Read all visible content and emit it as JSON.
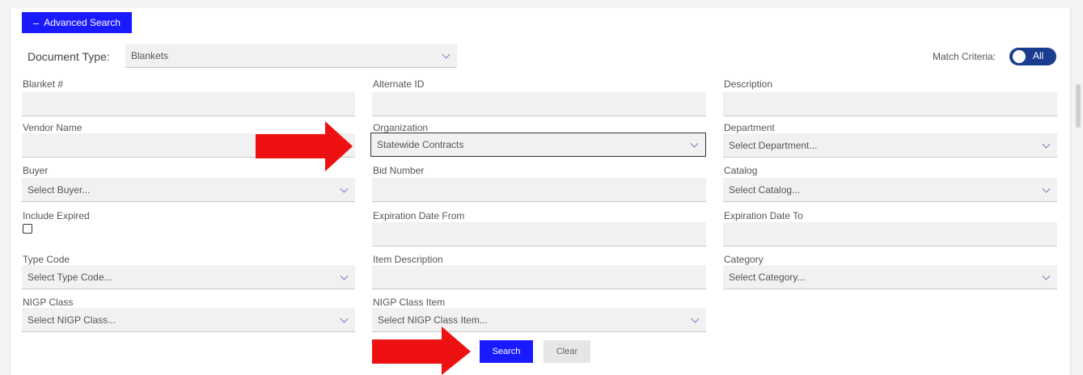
{
  "advanced_search": {
    "icon": "minus-icon",
    "label": "Advanced Search"
  },
  "document_type": {
    "label": "Document Type:",
    "value": "Blankets"
  },
  "match_criteria": {
    "label": "Match Criteria:",
    "value": "All"
  },
  "fields": {
    "blanket_number": {
      "label": "Blanket #"
    },
    "alternate_id": {
      "label": "Alternate ID"
    },
    "description": {
      "label": "Description"
    },
    "vendor_name": {
      "label": "Vendor Name"
    },
    "organization": {
      "label": "Organization",
      "value": "Statewide Contracts"
    },
    "department": {
      "label": "Department",
      "placeholder": "Select Department..."
    },
    "buyer": {
      "label": "Buyer",
      "placeholder": "Select Buyer..."
    },
    "bid_number": {
      "label": "Bid Number"
    },
    "catalog": {
      "label": "Catalog",
      "placeholder": "Select Catalog..."
    },
    "include_expired": {
      "label": "Include Expired",
      "checked": false
    },
    "expiration_date_from": {
      "label": "Expiration Date From"
    },
    "expiration_date_to": {
      "label": "Expiration Date To"
    },
    "type_code": {
      "label": "Type Code",
      "placeholder": "Select Type Code..."
    },
    "item_description": {
      "label": "Item Description"
    },
    "category": {
      "label": "Category",
      "placeholder": "Select Category..."
    },
    "nigp_class": {
      "label": "NIGP Class",
      "placeholder": "Select NIGP Class..."
    },
    "nigp_class_item": {
      "label": "NIGP Class Item",
      "placeholder": "Select NIGP Class Item..."
    }
  },
  "actions": {
    "search": "Search",
    "clear": "Clear"
  },
  "colors": {
    "primary": "#1a1aff",
    "toggle": "#1a3d8f",
    "arrow": "#ee1111"
  }
}
